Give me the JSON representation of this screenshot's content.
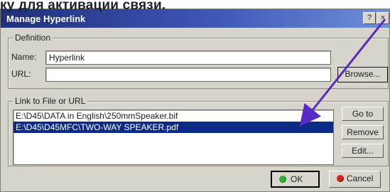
{
  "page": {
    "caption": "ку для активации связи."
  },
  "dialog": {
    "title": "Manage Hyperlink",
    "title_buttons": {
      "help": "?",
      "close": "×"
    }
  },
  "definition": {
    "label": "Definition",
    "name_label": "Name:",
    "name_value": "Hyperlink",
    "url_label": "URL:",
    "url_value": "",
    "browse_label": "Browse..."
  },
  "link": {
    "label": "Link to File or URL",
    "items": [
      "E:\\D45\\DATA in English\\250mmSpeaker.bif",
      "E:\\D45\\D45MFC\\TWO-WAY SPEAKER.pdf"
    ],
    "goto_label": "Go to",
    "remove_label": "Remove",
    "edit_label": "Edit..."
  },
  "footer": {
    "ok_label": "OK",
    "cancel_label": "Cancel"
  },
  "icons": {
    "ok": "ok-icon",
    "cancel": "cancel-icon",
    "help": "help-icon",
    "close": "close-icon",
    "annotation_arrow": "arrow-icon"
  },
  "colors": {
    "title_start": "#1f2f7a",
    "title_end": "#6e8fd8",
    "dialog_bg": "#d7d4cb",
    "selection": "#0d2b86",
    "arrow": "#5a2bc3",
    "ok_icon": "#2bb12a",
    "cancel_icon": "#d32222"
  }
}
